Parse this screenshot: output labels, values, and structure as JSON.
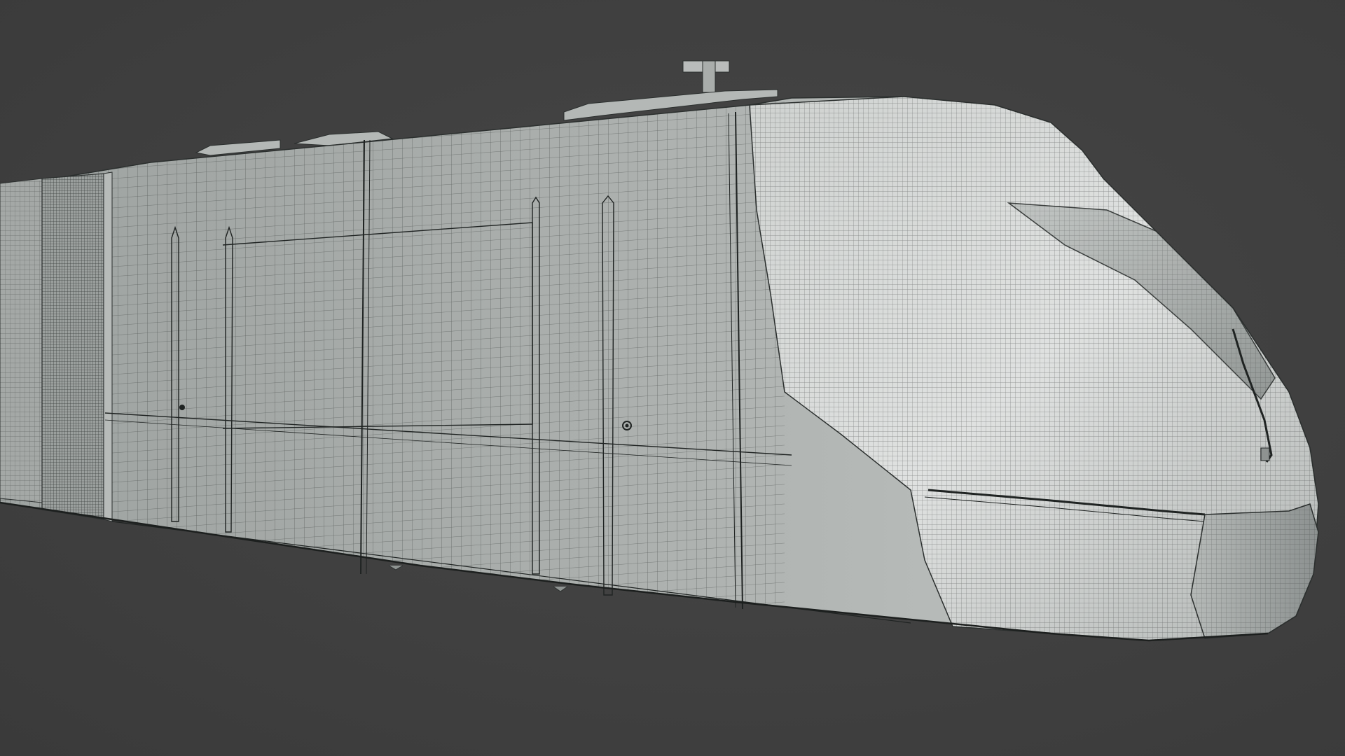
{
  "viewport": {
    "background_color": "#404040",
    "shading_mode": "solid-wireframe"
  },
  "model": {
    "type": "train-nose-section",
    "surface_color": "#a9adab",
    "highlight_color": "#d9dcda",
    "shadow_color": "#7d8280",
    "wire_color": "#2b2f2e"
  }
}
